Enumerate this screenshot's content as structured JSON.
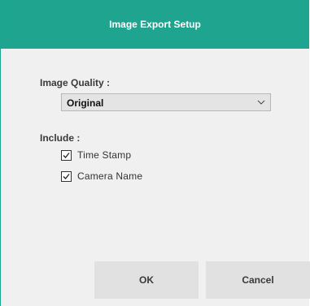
{
  "dialog": {
    "title": "Image Export Setup"
  },
  "image_quality": {
    "label": "Image Quality :",
    "selected": "Original",
    "arrow_icon": "chevron-down-icon"
  },
  "include": {
    "label": "Include :",
    "options": [
      {
        "label": "Time Stamp",
        "checked": true
      },
      {
        "label": "Camera Name",
        "checked": true
      }
    ]
  },
  "buttons": {
    "ok": "OK",
    "cancel": "Cancel"
  },
  "colors": {
    "title_bar": "#1fa48f",
    "background": "#f0f0f0",
    "button": "#e1e1e1"
  }
}
